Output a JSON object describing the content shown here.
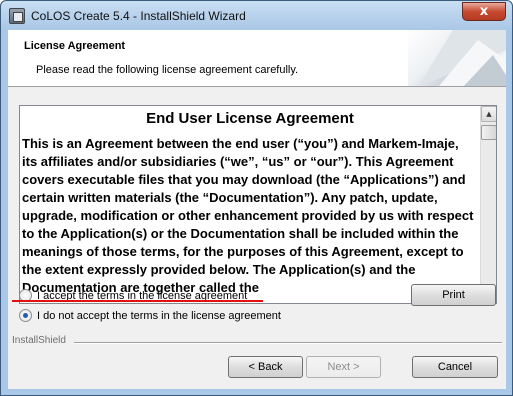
{
  "window": {
    "title": "CoLOS Create 5.4 - InstallShield Wizard",
    "close_glyph": "x"
  },
  "banner": {
    "title": "License Agreement",
    "subtitle": "Please read the following license agreement carefully."
  },
  "license": {
    "heading": "End User License Agreement",
    "body": "This is an Agreement between the end user (“you”) and Markem-Imaje, its affiliates and/or subsidiaries (“we”, “us” or “our”).  This Agreement covers executable files that you may download (the “Applications”) and certain written materials (the “Documentation”).  Any patch, update, upgrade, modification or other enhancement provided by us with respect to the Application(s) or the Documentation shall be included within the meanings of those terms, for the purposes of this Agreement, except to the extent expressly provided below.  The Application(s) and the Documentation are together called the"
  },
  "options": {
    "accept_label": "I accept the terms in the license agreement",
    "decline_label": "I do not accept the terms in the license agreement",
    "selected": "decline"
  },
  "buttons": {
    "print": "Print",
    "back": "< Back",
    "next": "Next >",
    "cancel": "Cancel"
  },
  "footer": {
    "brand": "InstallShield"
  },
  "colors": {
    "annotation_underline": "#e31212",
    "selected_radio": "#1f5fb0"
  },
  "icons": {
    "app": "installer-app-icon",
    "close": "close-icon",
    "scroll_up": "scroll-up-arrow-icon",
    "scroll_down": "scroll-down-arrow-icon"
  }
}
